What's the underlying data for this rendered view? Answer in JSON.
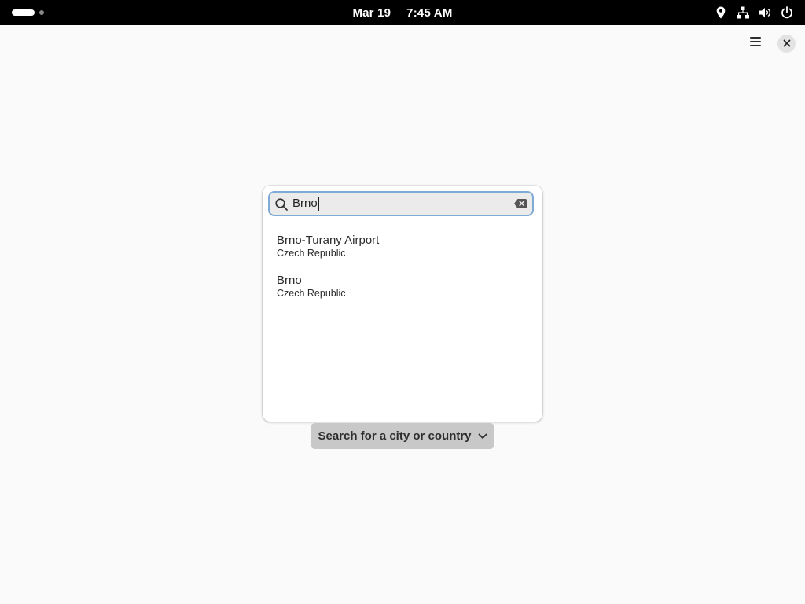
{
  "topbar": {
    "date": "Mar 19",
    "time": "7:45 AM",
    "icons": [
      "location-icon",
      "network-icon",
      "volume-icon",
      "power-icon"
    ]
  },
  "window": {
    "menu_icon": "hamburger-menu-icon",
    "close_icon": "close-icon"
  },
  "search": {
    "value": "Brno",
    "icon": "search-icon",
    "clear_icon": "clear-text-icon",
    "focus_color": "#7eaad6"
  },
  "results": [
    {
      "name": "Brno-Turany Airport",
      "country": "Czech Republic"
    },
    {
      "name": "Brno",
      "country": "Czech Republic"
    }
  ],
  "location_button": {
    "label": "Search for a city or country",
    "icon": "chevron-down-icon"
  }
}
